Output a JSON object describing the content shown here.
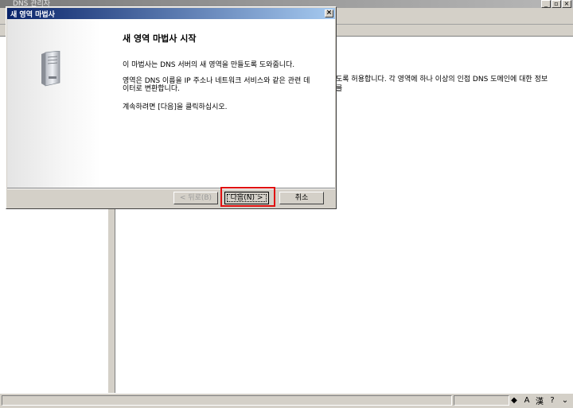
{
  "background_window": {
    "title": "DNS 관리자",
    "description_line_1": "도록 허용합니다. 각 영역에 하나 이상의 인접 DNS 도메인에 대한 정보",
    "description_line_2": "를"
  },
  "wizard": {
    "title": "새 영역 마법사",
    "heading": "새 영역 마법사 시작",
    "intro": "이 마법사는 DNS 서버의 새 영역을 만들도록 도와줍니다.",
    "zone_line_1": "영역은 DNS 이름을 IP 주소나 네트워크 서비스와 같은 관련 데",
    "zone_line_2": "이터로 변환합니다.",
    "continue": "계속하려면 [다음]을 클릭하십시오.",
    "buttons": {
      "back": "< 뒤로(B)",
      "next": "다음(N) >",
      "cancel": "취소"
    }
  },
  "colors": {
    "title_active": "#0a246a",
    "highlight": "#e01010"
  }
}
